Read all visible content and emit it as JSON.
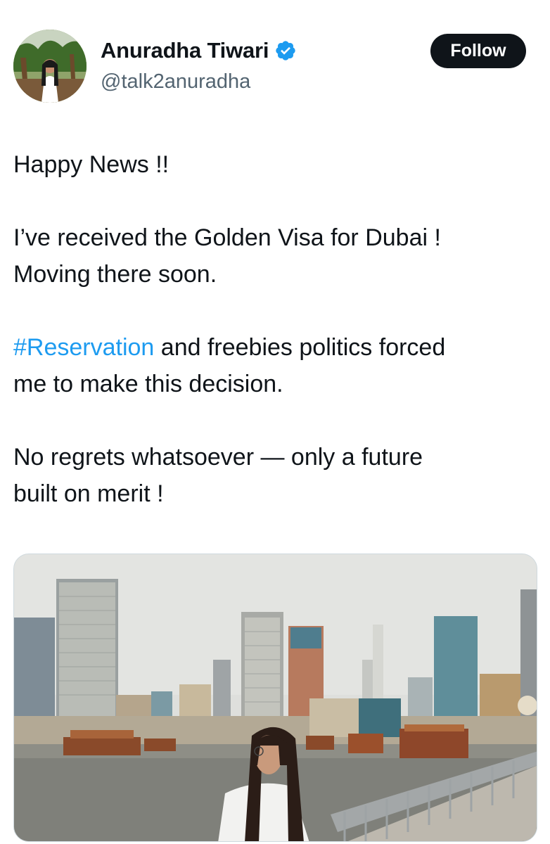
{
  "author": {
    "name": "Anuradha Tiwari",
    "handle": "@talk2anuradha",
    "verified_icon": "verified-badge-icon",
    "verified_color": "#1d9bf0"
  },
  "actions": {
    "follow_label": "Follow"
  },
  "tweet": {
    "line1": "Happy News !!",
    "line2": "I’ve received the Golden Visa for Dubai !",
    "line3": "Moving there soon.",
    "hashtag": "#Reservation",
    "line4_rest": " and freebies politics forced",
    "line5": "me to make this decision.",
    "line6": "No regrets whatsoever — only a future",
    "line7": "built on merit !"
  },
  "colors": {
    "text": "#0f1419",
    "secondary": "#536471",
    "link": "#1d9bf0",
    "follow_bg": "#0f1419"
  }
}
